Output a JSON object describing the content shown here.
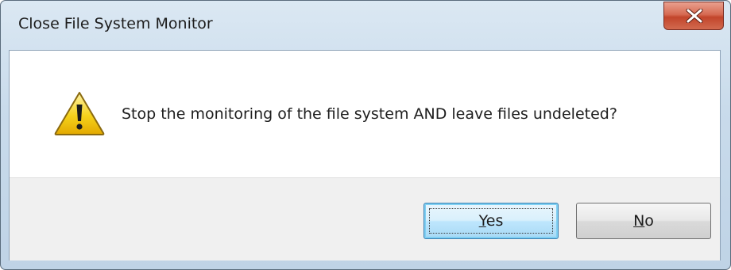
{
  "window": {
    "title": "Close File System Monitor",
    "close_icon": "close-x-icon"
  },
  "dialog": {
    "icon": "warning-icon",
    "message": "Stop the monitoring of the file system AND leave files undeleted?"
  },
  "buttons": {
    "yes": {
      "access_key": "Y",
      "rest": "es"
    },
    "no": {
      "access_key": "N",
      "rest": "o"
    }
  },
  "colors": {
    "close_red": "#c2452b",
    "default_button_blue": "#3c7fb1",
    "warning_yellow": "#f5d21c"
  }
}
